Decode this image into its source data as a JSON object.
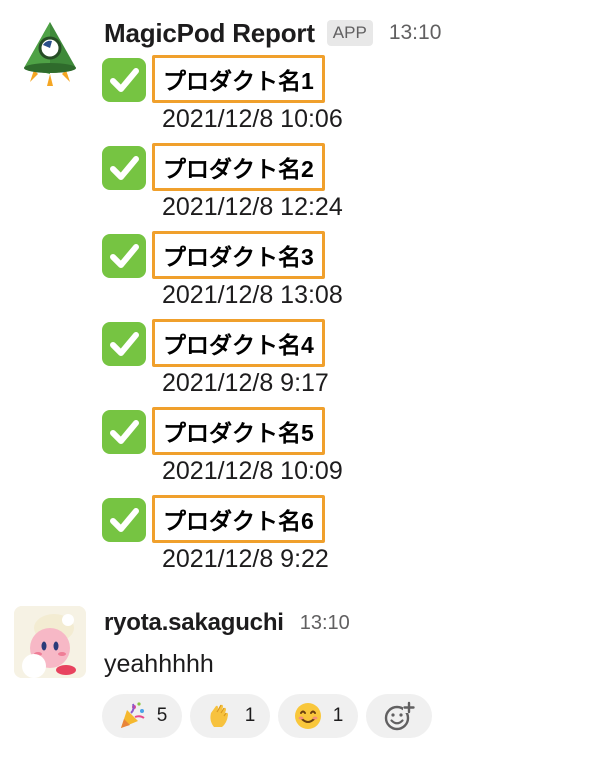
{
  "bot_message": {
    "sender": "MagicPod Report",
    "badge": "APP",
    "time": "13:10",
    "reports": [
      {
        "status_icon": "white-check-mark-icon",
        "product": "プロダクト名1",
        "datetime": "2021/12/8 10:06"
      },
      {
        "status_icon": "white-check-mark-icon",
        "product": "プロダクト名2",
        "datetime": "2021/12/8 12:24"
      },
      {
        "status_icon": "white-check-mark-icon",
        "product": "プロダクト名3",
        "datetime": "2021/12/8 13:08"
      },
      {
        "status_icon": "white-check-mark-icon",
        "product": "プロダクト名4",
        "datetime": "2021/12/8 9:17"
      },
      {
        "status_icon": "white-check-mark-icon",
        "product": "プロダクト名5",
        "datetime": "2021/12/8 10:09"
      },
      {
        "status_icon": "white-check-mark-icon",
        "product": "プロダクト名6",
        "datetime": "2021/12/8 9:22"
      }
    ]
  },
  "user_message": {
    "sender": "ryota.sakaguchi",
    "time": "13:10",
    "text": "yeahhhhh",
    "reactions": [
      {
        "emoji": "party-popper-icon",
        "count": "5"
      },
      {
        "emoji": "clapping-hands-icon",
        "count": "1"
      },
      {
        "emoji": "smiling-face-icon",
        "count": "1"
      }
    ],
    "add_reaction_icon": "add-reaction-icon"
  },
  "colors": {
    "highlight_border": "#f0a02c",
    "check_green": "#76c442",
    "pill_bg": "#f0f0f0",
    "muted_text": "#616061"
  }
}
